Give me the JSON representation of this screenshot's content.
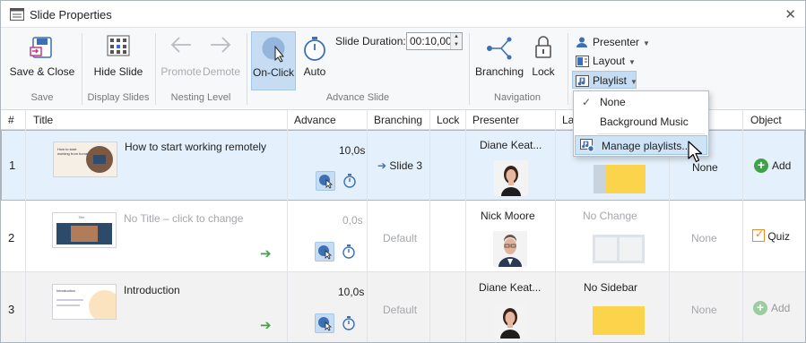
{
  "window": {
    "title": "Slide Properties",
    "close_glyph": "✕"
  },
  "ribbon": {
    "save_close": "Save & Close",
    "hide_slide": "Hide Slide",
    "promote": "Promote",
    "demote": "Demote",
    "on_click": "On-Click",
    "auto": "Auto",
    "slide_duration_label": "Slide Duration:",
    "slide_duration_value": "00:10,00",
    "branching": "Branching",
    "lock": "Lock",
    "presenter": "Presenter",
    "layout": "Layout",
    "playlist": "Playlist",
    "groups": {
      "save": "Save",
      "display_slides": "Display Slides",
      "nesting_level": "Nesting Level",
      "advance_slide": "Advance Slide",
      "navigation": "Navigation"
    }
  },
  "playlist_menu": {
    "items": [
      "None",
      "Background Music",
      "Manage playlists..."
    ]
  },
  "table": {
    "headers": [
      "#",
      "Title",
      "Advance",
      "Branching",
      "Lock",
      "Presenter",
      "La",
      "t",
      "Object"
    ],
    "rows": [
      {
        "num": "1",
        "title": "How to start working remotely",
        "advance": "10,0s",
        "branching": "Slide 3",
        "presenter": "Diane Keat...",
        "layout": "",
        "t": "None",
        "object": "Add",
        "thumb_text": "How to start working from home"
      },
      {
        "num": "2",
        "title": "No Title – click to change",
        "advance": "0,0s",
        "branching": "Default",
        "presenter": "Nick Moore",
        "layout": "No Change",
        "t": "None",
        "object": "Quiz",
        "thumb_text": "Title"
      },
      {
        "num": "3",
        "title": "Introduction",
        "advance": "10,0s",
        "branching": "Default",
        "presenter": "Diane Keat...",
        "layout": "No Sidebar",
        "t": "None",
        "object": "Add",
        "thumb_text": "Introduction"
      }
    ]
  },
  "colors": {
    "accent": "#c5dcf2",
    "selection": "#e4f0fb",
    "green": "#3fa24a",
    "yellow": "#fbd44b"
  }
}
